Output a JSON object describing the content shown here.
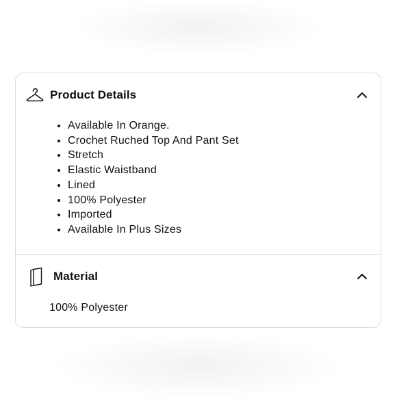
{
  "product_details": {
    "title": "Product Details",
    "icon": "hanger-icon",
    "expanded": true,
    "items": [
      "Available In Orange.",
      "Crochet Ruched Top And Pant Set",
      "Stretch",
      "Elastic Waistband",
      "Lined",
      "100% Polyester",
      "Imported",
      "Available In Plus Sizes"
    ]
  },
  "material": {
    "title": "Material",
    "icon": "fabric-swatch-icon",
    "expanded": true,
    "text": "100% Polyester"
  }
}
